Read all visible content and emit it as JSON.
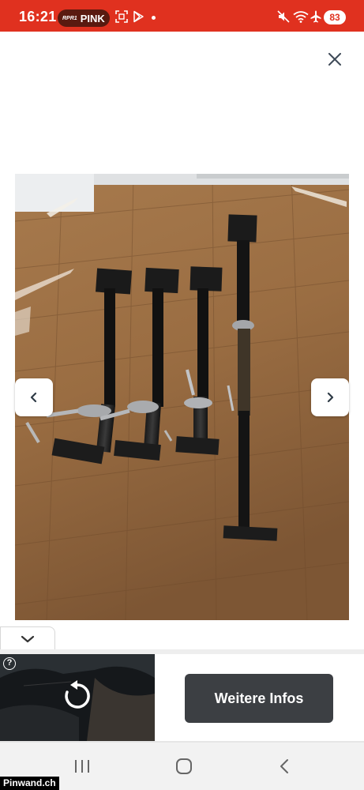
{
  "status_bar": {
    "time": "16:21",
    "radio_logo": "RPR1",
    "radio_name": "PINK",
    "battery": "83",
    "icons": [
      "screenshot-icon",
      "play-store-icon",
      "notification-dot",
      "mute-icon",
      "wifi-icon",
      "airplane-icon",
      "battery-icon"
    ],
    "color": "#e0311f"
  },
  "gallery": {
    "close_icon": "close-icon",
    "prev_icon": "chevron-left-icon",
    "next_icon": "chevron-right-icon",
    "image_subject": "photo-four-steel-props-on-wood-floor"
  },
  "ad": {
    "collapse_icon": "chevron-down-icon",
    "info_label": "?",
    "replay_icon": "replay-icon",
    "cta_label": "Weitere Infos",
    "cta_color": "#3c3f43"
  },
  "nav_bar": {
    "icons": [
      "recent-apps-icon",
      "home-icon",
      "back-icon"
    ]
  },
  "watermark": "Pinwand.ch"
}
